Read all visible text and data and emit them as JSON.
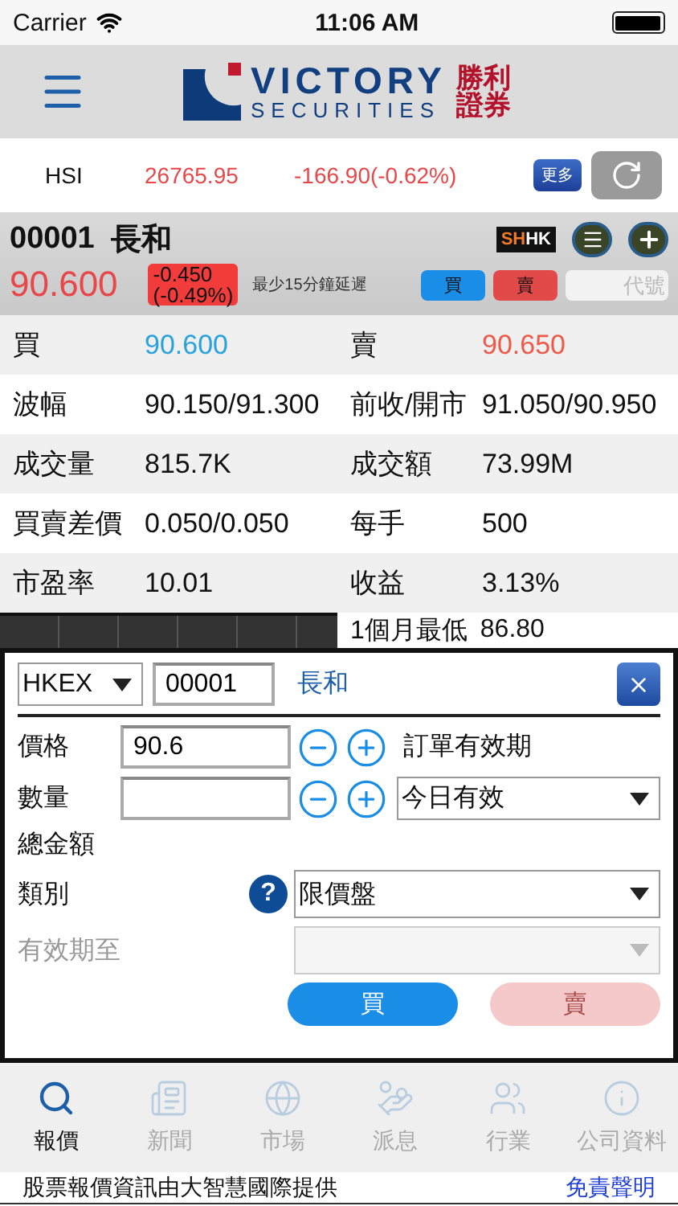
{
  "status_bar": {
    "carrier": "Carrier",
    "time": "11:06 AM"
  },
  "header": {
    "logo_en_top": "VICTORY",
    "logo_en_bottom": "SECURITIES",
    "logo_zh_top": "勝利",
    "logo_zh_bottom": "證券"
  },
  "index": {
    "name": "HSI",
    "value": "26765.95",
    "change": "-166.90(-0.62%)",
    "more_button": "更多"
  },
  "stock": {
    "code": "00001",
    "name": "長和",
    "badge_parts": [
      "SH",
      "HK"
    ],
    "price": "90.600",
    "change": "-0.450",
    "change_pct": "(-0.49%)",
    "delay_note": "最少15分鐘延遲",
    "buy_button": "買",
    "sell_button": "賣",
    "code_placeholder": "代號"
  },
  "quote_rows": [
    {
      "kind": "bid_ask",
      "label": "買",
      "value": "90.600",
      "label2": "賣",
      "value2": "90.650"
    },
    {
      "kind": "plain",
      "label": "波幅",
      "value": "90.150/91.300",
      "label2": "前收/開市",
      "value2": "91.050/90.950"
    },
    {
      "kind": "plain",
      "label": "成交量",
      "value": "815.7K",
      "label2": "成交額",
      "value2": "73.99M"
    },
    {
      "kind": "plain",
      "label": "買賣差價",
      "value": "0.050/0.050",
      "label2": "每手",
      "value2": "500"
    },
    {
      "kind": "plain",
      "label": "市盈率",
      "value": "10.01",
      "label2": "收益",
      "value2": "3.13%"
    }
  ],
  "partial_row": {
    "label": "1個月最低",
    "value": "86.80"
  },
  "order": {
    "exchange": "HKEX",
    "code": "00001",
    "name": "長和",
    "price_label": "價格",
    "price": "90.6",
    "quantity_label": "數量",
    "validity_label": "訂單有效期",
    "validity": "今日有效",
    "total_label": "總金額",
    "type_label": "類別",
    "help_mark": "?",
    "type": "限價盤",
    "expiry_label": "有效期至",
    "expiry_disabled": true,
    "buy_button": "買",
    "sell_button": "賣",
    "sell_disabled": true
  },
  "tabs": [
    {
      "label": "報價",
      "selected": true
    },
    {
      "label": "新聞",
      "selected": false
    },
    {
      "label": "市場",
      "selected": false
    },
    {
      "label": "派息",
      "selected": false
    },
    {
      "label": "行業",
      "selected": false
    },
    {
      "label": "公司資料",
      "selected": false
    }
  ],
  "footer": {
    "text": "股票報價資訊由大智慧國際提供",
    "link": "免責聲明"
  }
}
